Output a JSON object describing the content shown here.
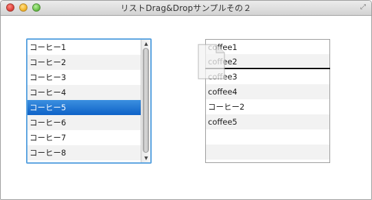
{
  "window": {
    "title": "リストDrag&Dropサンプルその２"
  },
  "left_list": {
    "items": [
      "コーヒー1",
      "コーヒー2",
      "コーヒー3",
      "コーヒー4",
      "コーヒー5",
      "コーヒー6",
      "コーヒー7",
      "コーヒー8"
    ],
    "selected_index": 4
  },
  "right_list": {
    "items": [
      "coffee1",
      "coffee2",
      "coffee3",
      "coffee4",
      "コーヒー2",
      "coffee5"
    ]
  },
  "icons": {
    "window_close": "close-icon",
    "window_minimize": "minimize-icon",
    "window_zoom": "zoom-icon",
    "fullscreen": "fullscreen-icon",
    "drag_document": "document-icon"
  },
  "colors": {
    "selection": "#1a6fd2",
    "focus_ring": "#5aa3e0",
    "alt_row": "#f2f2f2"
  }
}
